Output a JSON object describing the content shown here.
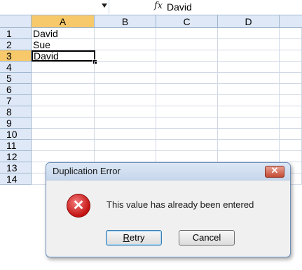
{
  "formula_bar": {
    "fx_symbol": "fx",
    "value": "David"
  },
  "columns": [
    "A",
    "B",
    "C",
    "D"
  ],
  "rows": [
    "1",
    "2",
    "3",
    "4",
    "5",
    "6",
    "7",
    "8",
    "9",
    "10",
    "11",
    "12",
    "13",
    "14"
  ],
  "cells": {
    "A1": "David",
    "A2": "Sue",
    "A3": "David"
  },
  "active_cell": "A3",
  "dialog": {
    "title": "Duplication Error",
    "close_symbol": "✕",
    "icon": "error-icon",
    "message": "This value has already been entered",
    "retry_prefix": "",
    "retry_underlined": "R",
    "retry_rest": "etry",
    "cancel_label": "Cancel"
  },
  "colors": {
    "header_bg": "#dfe8f6",
    "active_header_bg": "#f7c96b",
    "dialog_close": "#c44b34"
  }
}
